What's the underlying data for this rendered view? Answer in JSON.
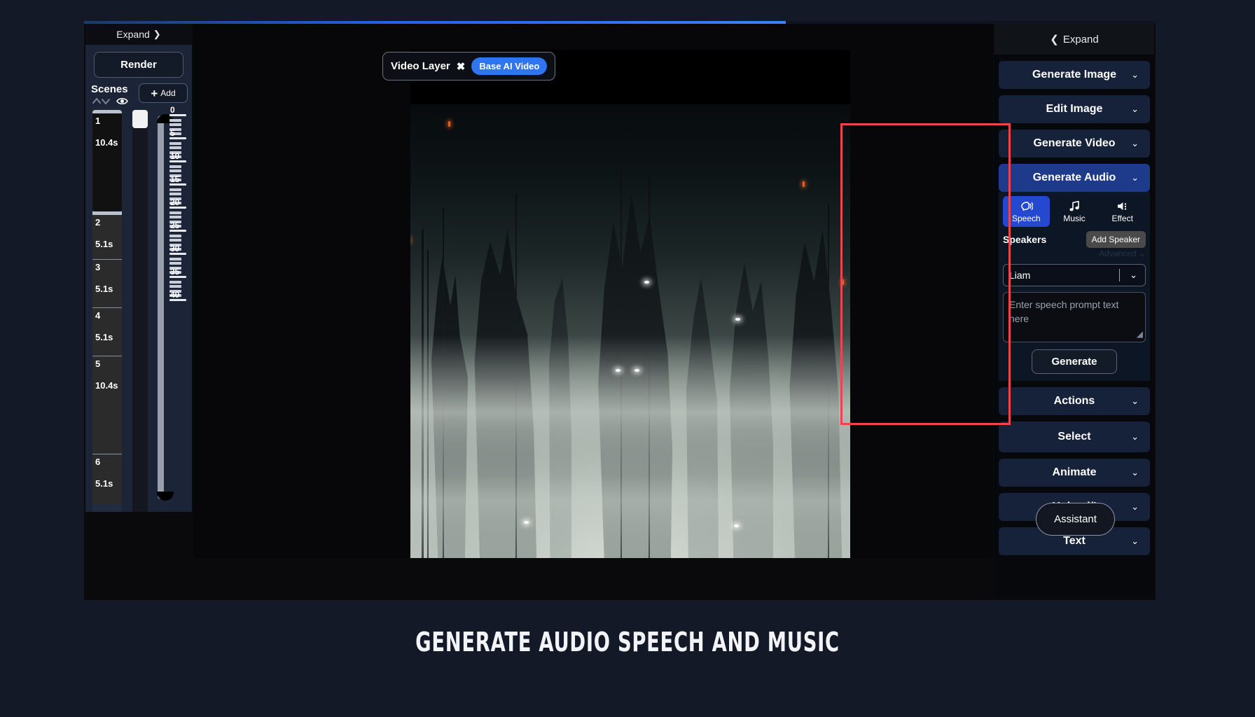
{
  "left_panel": {
    "expand_label": "Expand",
    "expand_icon": "chevron-right-icon",
    "render_label": "Render",
    "scenes_label": "Scenes",
    "sort_icon": "chevron-up-down-icon",
    "visibility_icon": "eye-icon",
    "add_label": "Add",
    "add_icon": "plus-icon",
    "scenes": [
      {
        "index": "1",
        "duration": "10.4s"
      },
      {
        "index": "2",
        "duration": "5.1s"
      },
      {
        "index": "3",
        "duration": "5.1s"
      },
      {
        "index": "4",
        "duration": "5.1s"
      },
      {
        "index": "5",
        "duration": "10.4s"
      },
      {
        "index": "6",
        "duration": "5.1s"
      }
    ],
    "ruler_labels": [
      "0",
      "5",
      "10",
      "15",
      "20",
      "25",
      "30",
      "35",
      "40"
    ]
  },
  "canvas": {
    "layer_name": "Video Layer",
    "close_icon": "close-icon",
    "layer_pill": "Base AI Video"
  },
  "right_panel": {
    "expand_label": "Expand",
    "expand_icon": "chevron-left-icon",
    "sections": {
      "generate_image": "Generate Image",
      "edit_image": "Edit Image",
      "generate_video": "Generate Video",
      "generate_audio": "Generate Audio",
      "actions": "Actions",
      "select": "Select",
      "animate": "Animate",
      "upload": "Upload/I",
      "text": "Text"
    },
    "chevron_icon": "chevron-down-icon",
    "audio": {
      "tabs": [
        {
          "label": "Speech",
          "icon": "speech-head-icon",
          "selected": true
        },
        {
          "label": "Music",
          "icon": "music-note-icon",
          "selected": false
        },
        {
          "label": "Effect",
          "icon": "speaker-wave-icon",
          "selected": false
        }
      ],
      "speakers_label": "Speakers",
      "add_speaker_label": "Add Speaker",
      "advanced_label": "Advanced",
      "voice_value": "Liam",
      "voice_chevron": "chevron-down-icon",
      "prompt_placeholder": "Enter speech prompt text here",
      "generate_label": "Generate"
    }
  },
  "assistant": {
    "label": "Assistant"
  },
  "caption": {
    "text": "GENERATE AUDIO SPEECH AND MUSIC"
  },
  "colors": {
    "accent_blue": "#2548d0",
    "active_section": "#1e3a8a",
    "highlight_red": "#f4424a",
    "pill_blue": "#2f74f0",
    "page_bg": "#131927"
  }
}
